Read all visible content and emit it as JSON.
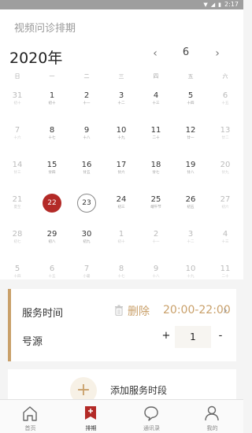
{
  "status_bar": {
    "time": "2:17",
    "icons": [
      "wifi-icon",
      "signal-icon",
      "battery-icon"
    ]
  },
  "header": {
    "title": "视频问诊排期",
    "year": "2020年",
    "month": "6",
    "prev_icon": "‹",
    "next_icon": "›"
  },
  "weekdays": [
    "日",
    "一",
    "二",
    "三",
    "四",
    "五",
    "六"
  ],
  "calendar": {
    "rows": [
      [
        {
          "d": "31",
          "l": "初十",
          "o": true
        },
        {
          "d": "1",
          "l": "初十",
          "o": false
        },
        {
          "d": "2",
          "l": "十一",
          "o": false
        },
        {
          "d": "3",
          "l": "十二",
          "o": false
        },
        {
          "d": "4",
          "l": "十三",
          "o": false
        },
        {
          "d": "5",
          "l": "十四",
          "o": false
        },
        {
          "d": "6",
          "l": "十五",
          "o": true
        }
      ],
      [
        {
          "d": "7",
          "l": "十六",
          "o": true
        },
        {
          "d": "8",
          "l": "十七",
          "o": false
        },
        {
          "d": "9",
          "l": "十八",
          "o": false
        },
        {
          "d": "10",
          "l": "十九",
          "o": false
        },
        {
          "d": "11",
          "l": "二十",
          "o": false
        },
        {
          "d": "12",
          "l": "廿一",
          "o": false
        },
        {
          "d": "13",
          "l": "廿二",
          "o": true
        }
      ],
      [
        {
          "d": "14",
          "l": "廿三",
          "o": true
        },
        {
          "d": "15",
          "l": "廿四",
          "o": false
        },
        {
          "d": "16",
          "l": "廿五",
          "o": false
        },
        {
          "d": "17",
          "l": "廿六",
          "o": false
        },
        {
          "d": "18",
          "l": "廿七",
          "o": false
        },
        {
          "d": "19",
          "l": "廿八",
          "o": false
        },
        {
          "d": "20",
          "l": "廿九",
          "o": true
        }
      ],
      [
        {
          "d": "21",
          "l": "夏至",
          "o": true
        },
        {
          "d": "22",
          "l": "",
          "o": false,
          "sel": true
        },
        {
          "d": "23",
          "l": "",
          "o": false,
          "today": true
        },
        {
          "d": "24",
          "l": "初三",
          "o": false
        },
        {
          "d": "25",
          "l": "端午节",
          "o": false
        },
        {
          "d": "26",
          "l": "初五",
          "o": false
        },
        {
          "d": "27",
          "l": "初六",
          "o": true
        }
      ],
      [
        {
          "d": "28",
          "l": "初七",
          "o": true
        },
        {
          "d": "29",
          "l": "初八",
          "o": false
        },
        {
          "d": "30",
          "l": "初九",
          "o": false
        },
        {
          "d": "1",
          "l": "初十",
          "o": true
        },
        {
          "d": "2",
          "l": "十一",
          "o": true
        },
        {
          "d": "3",
          "l": "十二",
          "o": true
        },
        {
          "d": "4",
          "l": "十三",
          "o": true
        }
      ],
      [
        {
          "d": "5",
          "l": "十四",
          "o": true
        },
        {
          "d": "6",
          "l": "十五",
          "o": true
        },
        {
          "d": "7",
          "l": "小暑",
          "o": true
        },
        {
          "d": "8",
          "l": "十七",
          "o": true
        },
        {
          "d": "9",
          "l": "十八",
          "o": true
        },
        {
          "d": "10",
          "l": "十九",
          "o": true
        },
        {
          "d": "11",
          "l": "二十",
          "o": true
        }
      ]
    ]
  },
  "service": {
    "time_label": "服务时间",
    "delete_label": "删除",
    "time_range": "20:00-22:00",
    "chevron": "›",
    "number_label": "号源",
    "plus": "+",
    "count": "1",
    "minus": "-"
  },
  "add_service": {
    "plus": "+",
    "label": "添加服务时段"
  },
  "tabbar": [
    {
      "label": "首页",
      "icon": "home-icon",
      "active": false
    },
    {
      "label": "排期",
      "icon": "schedule-icon",
      "active": true
    },
    {
      "label": "通讯录",
      "icon": "chat-icon",
      "active": false
    },
    {
      "label": "我的",
      "icon": "user-icon",
      "active": false
    }
  ],
  "colors": {
    "accent": "#c9a06a",
    "selected": "#b32a27",
    "status_bar": "#9e9e9e"
  }
}
